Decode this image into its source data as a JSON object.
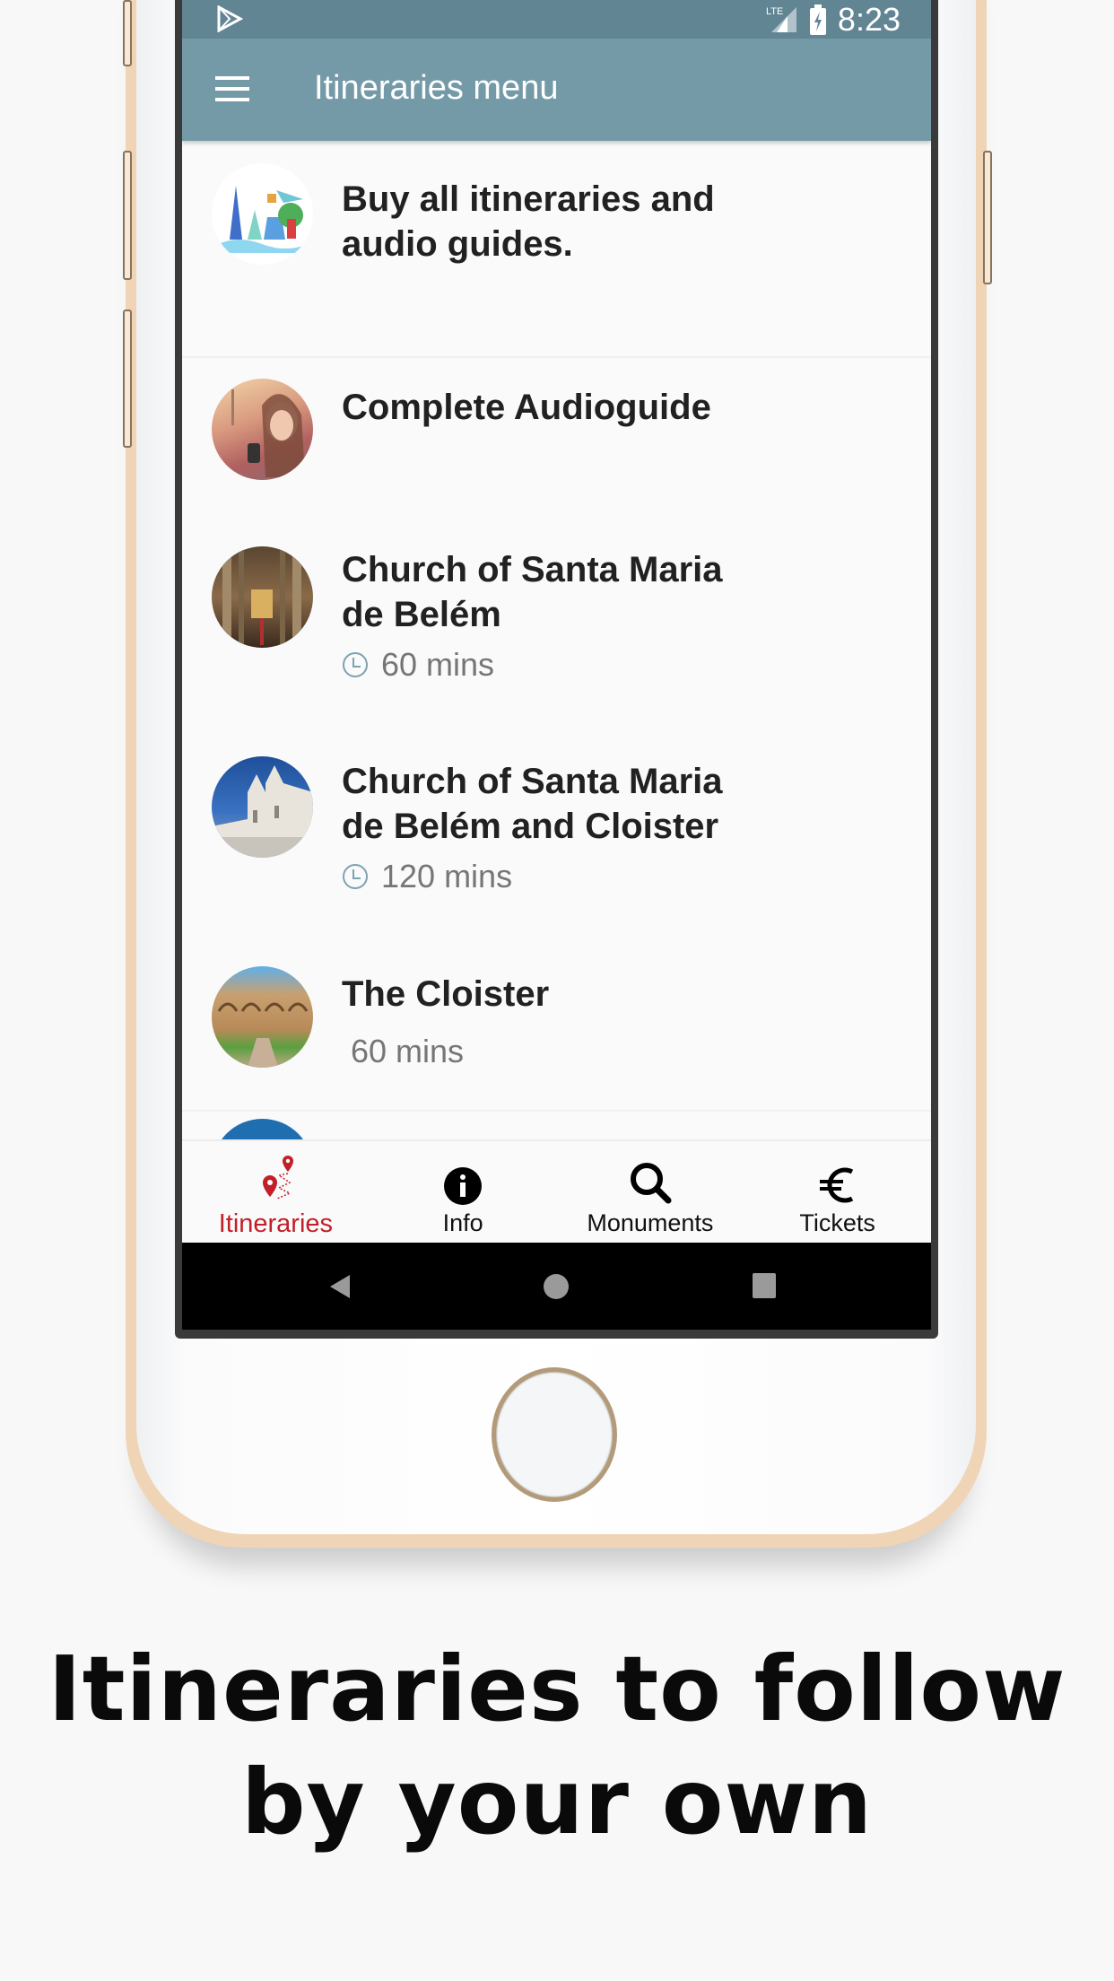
{
  "status_bar": {
    "time": "8:23",
    "network": "LTE",
    "icons": [
      "play-store-icon",
      "signal-icon",
      "battery-charging-icon"
    ]
  },
  "app_bar": {
    "title": "Itineraries menu",
    "menu_icon": "hamburger-menu-icon"
  },
  "itineraries": [
    {
      "title": "Buy all itineraries and audio guides.",
      "duration": null,
      "thumbnail": "travel-landmarks-illustration"
    },
    {
      "title": "Complete Audioguide",
      "duration": null,
      "thumbnail": "woman-with-headphones-photo"
    },
    {
      "title": "Church of Santa Maria de Belém",
      "duration": "60 mins",
      "thumbnail": "church-interior-photo"
    },
    {
      "title": "Church of Santa Maria de Belém and Cloister",
      "duration": "120 mins",
      "thumbnail": "monastery-exterior-photo"
    },
    {
      "title": "The Cloister",
      "duration": "60 mins",
      "thumbnail": "cloister-courtyard-photo"
    }
  ],
  "bottom_nav": {
    "items": [
      {
        "label": "Itineraries",
        "icon": "route-pins-icon",
        "active": true
      },
      {
        "label": "Info",
        "icon": "info-icon",
        "active": false
      },
      {
        "label": "Monuments",
        "icon": "search-icon",
        "active": false
      },
      {
        "label": "Tickets",
        "icon": "euro-icon",
        "active": false
      }
    ],
    "active_color": "#c31f28"
  },
  "caption": {
    "line1": "Itineraries to follow",
    "line2": "by your own"
  },
  "colors": {
    "status_bar": "#628594",
    "app_bar": "#749aa8",
    "phone_frame": "#f0d4b6"
  }
}
